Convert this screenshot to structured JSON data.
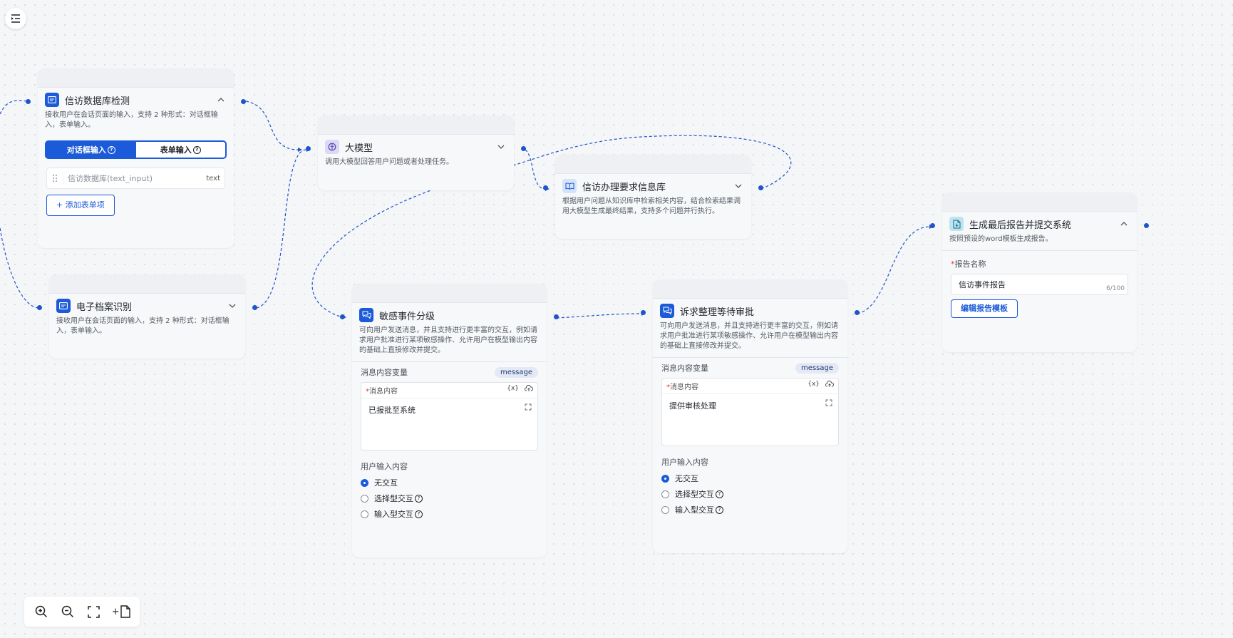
{
  "colors": {
    "accent": "#1b5ad8",
    "port": "#1f55c8",
    "edge": "#1f55c8",
    "canvas": "#f5f6f8"
  },
  "nodes": {
    "db_detect": {
      "title": "信访数据库检测",
      "icon": "input-icon",
      "desc": "接收用户在会话页面的输入，支持 2 种形式：对话框输入，表单输入。",
      "tab_dialog": "对话框输入",
      "tab_form": "表单输入",
      "field_placeholder": "信访数据库(text_input)",
      "field_tag": "text",
      "add_button": "+ 添加表单项"
    },
    "archive": {
      "title": "电子档案识别",
      "icon": "input-icon",
      "desc": "接收用户在会话页面的输入，支持 2 种形式：对话框输入，表单输入。"
    },
    "llm": {
      "title": "大模型",
      "icon": "brain-icon",
      "desc": "调用大模型回答用户问题或者处理任务。"
    },
    "kb": {
      "title": "信访办理要求信息库",
      "icon": "book-icon",
      "desc": "根据用户问题从知识库中检索相关内容，结合检索结果调用大模型生成最终结果，支持多个问题并行执行。"
    },
    "sensitive": {
      "title": "敏感事件分级",
      "icon": "chat-icon",
      "desc": "可向用户发送消息，并且支持进行更丰富的交互，例如请求用户批准进行某项敏感操作、允许用户在模型输出内容的基础上直接修改并提交。",
      "var_label": "消息内容变量",
      "var_pill": "message",
      "msg_label": "消息内容",
      "msg_var": "{x}",
      "msg_value": "已报批至系统",
      "input_label": "用户输入内容",
      "options": [
        "无交互",
        "选择型交互",
        "输入型交互"
      ]
    },
    "appeal": {
      "title": "诉求整理等待审批",
      "icon": "chat-icon",
      "desc": "可向用户发送消息，并且支持进行更丰富的交互，例如请求用户批准进行某项敏感操作、允许用户在模型输出内容的基础上直接修改并提交。",
      "var_label": "消息内容变量",
      "var_pill": "message",
      "msg_label": "消息内容",
      "msg_var": "{x}",
      "msg_value": "提供审核处理",
      "input_label": "用户输入内容",
      "options": [
        "无交互",
        "选择型交互",
        "输入型交互"
      ]
    },
    "report": {
      "title": "生成最后报告并提交系统",
      "icon": "document-icon",
      "desc": "按照预设的word模板生成报告。",
      "name_label": "报告名称",
      "name_value": "信访事件报告",
      "name_count": "6/100",
      "edit_button": "编辑报告模板"
    }
  },
  "toolbar": {
    "items": [
      "zoom-in-icon",
      "zoom-out-icon",
      "fit-screen-icon",
      "add-document-icon"
    ],
    "add_prefix": "+"
  }
}
